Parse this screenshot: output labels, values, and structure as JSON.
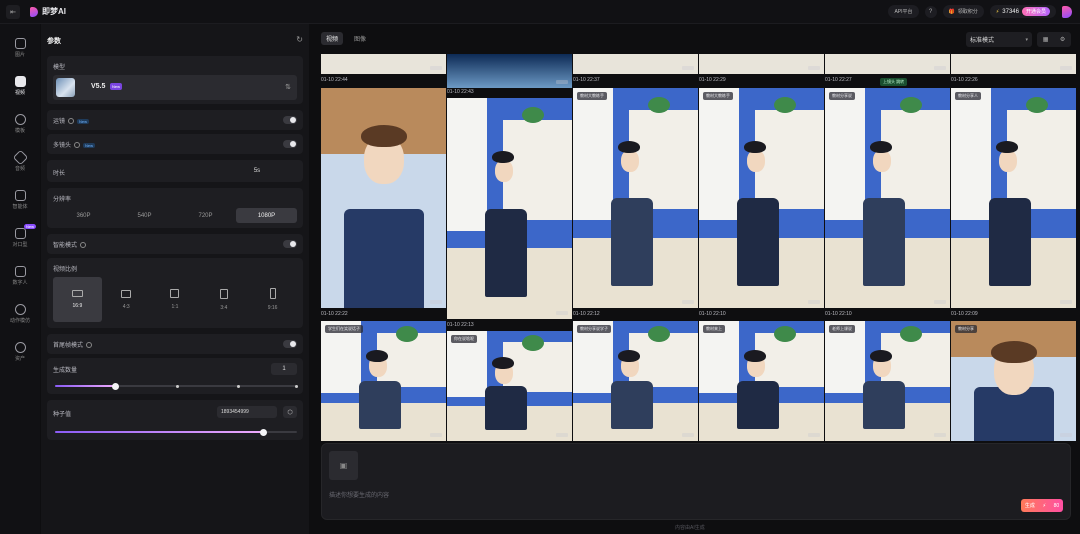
{
  "app": {
    "title": "即梦AI"
  },
  "topbar": {
    "api": "API平台",
    "gift": "领取积分",
    "points": "37346",
    "member": "开通会员"
  },
  "rail": [
    {
      "label": "图片",
      "icon": "image-icon"
    },
    {
      "label": "视频",
      "icon": "video-icon",
      "active": true
    },
    {
      "label": "模板",
      "icon": "sparkle-icon"
    },
    {
      "label": "音频",
      "icon": "audio-icon"
    },
    {
      "label": "智能体",
      "icon": "agent-icon",
      "badge": "New"
    },
    {
      "label": "对口型",
      "icon": "lipsync-icon"
    },
    {
      "label": "数字人",
      "icon": "avatar-icon"
    },
    {
      "label": "动作模仿",
      "icon": "motion-icon"
    },
    {
      "label": "资产",
      "icon": "asset-icon"
    }
  ],
  "params": {
    "title": "参数",
    "model_label": "模型",
    "model_name": "V5.5",
    "model_tag": "New",
    "camera_control": "运镜",
    "multi_shot": "多镜头",
    "new_badge": "New",
    "duration_label": "时长",
    "duration_value": "5s",
    "resolution_label": "分辨率",
    "resolutions": [
      "360P",
      "540P",
      "720P",
      "1080P"
    ],
    "resolution_selected": "1080P",
    "smart_mode": "智能模式",
    "ratio_label": "视频比例",
    "ratios": [
      "16:9",
      "4:3",
      "1:1",
      "3:4",
      "9:16"
    ],
    "ratio_selected": "16:9",
    "first_last_frame": "首尾帧模式",
    "count_label": "生成数量",
    "count_value": "1",
    "count_fraction": 0.25,
    "seed_label": "种子值",
    "seed_value": "1893454999",
    "seed_fraction": 0.86
  },
  "main": {
    "tabs": [
      "视频",
      "图像"
    ],
    "active_tab": "视频",
    "mode_select": "标准模式",
    "composer_placeholder": "描述你想要生成的内容",
    "generate_label": "生成",
    "generate_cost": "80",
    "footer": "内容由AI生成"
  },
  "grid_timestamps": {
    "row0": [
      "01-10 22:44",
      "",
      "01-10 22:37",
      "01-10 22:29",
      "01-10 22:27",
      "01-10 22:26"
    ],
    "row0b": "01-10 22:43",
    "row1": [
      "01-10 22:22",
      "",
      "01-10 22:12",
      "01-10 22:10",
      "01-10 22:10",
      "01-10 22:09"
    ],
    "row1b": "01-10 22:13"
  },
  "tile_tags": {
    "r1": [
      "",
      "",
      "教材大教练手",
      "教材大教练手",
      "教材分享说",
      "教材分享人"
    ],
    "r2": [
      "学生们在笑说话子",
      "你在说啥呢",
      "教材分享说学子",
      "教材来上",
      "老师上课说",
      "教材分享"
    ]
  },
  "tooltip": "上镜头 跳转"
}
